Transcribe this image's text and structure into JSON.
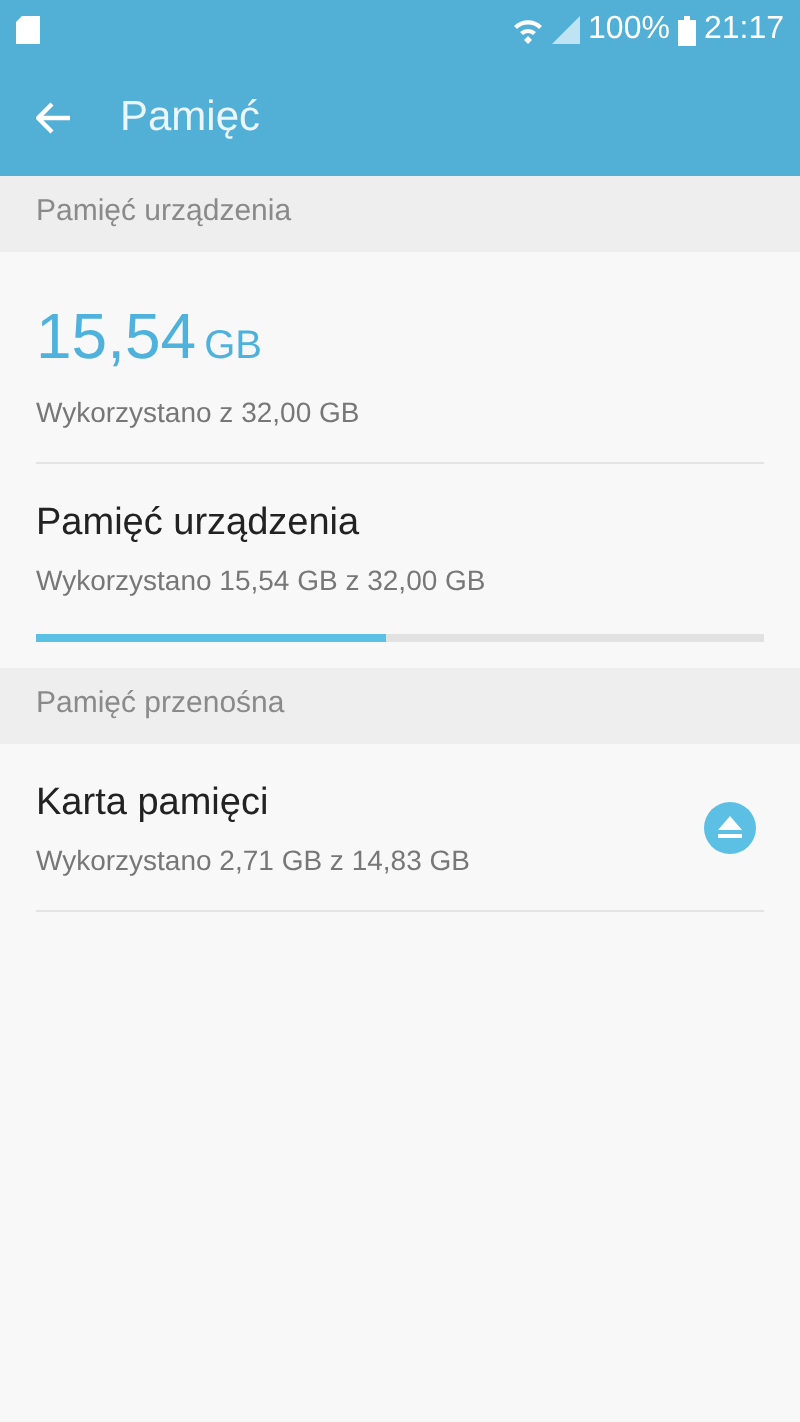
{
  "status_bar": {
    "percent": "100%",
    "time": "21:17"
  },
  "app_bar": {
    "title": "Pamięć"
  },
  "sections": [
    {
      "header": "Pamięć urządzenia",
      "items": [
        {
          "kind": "summary",
          "value": "15,54",
          "unit": "GB",
          "subtitle": "Wykorzystano z 32,00 GB"
        },
        {
          "kind": "bar",
          "title": "Pamięć urządzenia",
          "subtitle": "Wykorzystano 15,54 GB z 32,00 GB",
          "level": 0.48
        }
      ]
    },
    {
      "header": "Pamięć przenośna",
      "items": [
        {
          "kind": "eject",
          "title": "Karta pamięci",
          "subtitle": "Wykorzystano 2,71 GB z 14,83 GB"
        }
      ]
    }
  ]
}
